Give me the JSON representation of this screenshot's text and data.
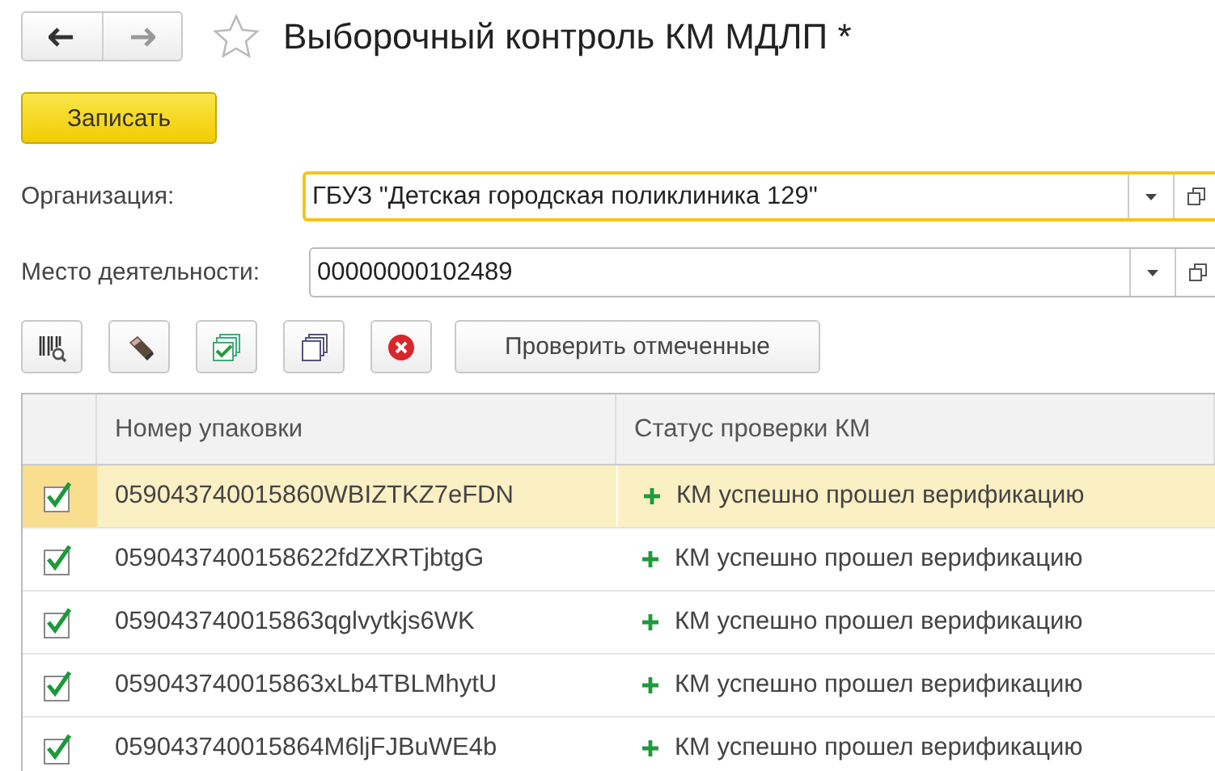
{
  "window": {
    "title": "Выборочный контроль КМ МДЛП *",
    "favorite": false
  },
  "save_button": "Записать",
  "fields": [
    {
      "label": "Организация:",
      "value": "ГБУЗ \"Детская городская поликлиника 129\"",
      "focused": true
    },
    {
      "label": "Место деятельности:",
      "value": "00000000102489",
      "focused": false
    }
  ],
  "toolbar": {
    "check_button": "Проверить отмеченные"
  },
  "table": {
    "columns": [
      "Номер упаковки",
      "Статус проверки КМ"
    ],
    "rows": [
      {
        "checked": true,
        "selected": true,
        "code": "059043740015860WBIZTKZ7eFDN",
        "status": "КМ успешно прошел верификацию"
      },
      {
        "checked": true,
        "selected": false,
        "code": "0590437400158622fdZXRTjbtgG",
        "status": "КМ успешно прошел верификацию"
      },
      {
        "checked": true,
        "selected": false,
        "code": "059043740015863qglvytkjs6WK",
        "status": "КМ успешно прошел верификацию"
      },
      {
        "checked": true,
        "selected": false,
        "code": "059043740015863xLb4TBLMhytU",
        "status": "КМ успешно прошел верификацию"
      },
      {
        "checked": true,
        "selected": false,
        "code": "059043740015864M6ljFJBuWE4b",
        "status": "КМ успешно прошел верификацию"
      }
    ]
  }
}
